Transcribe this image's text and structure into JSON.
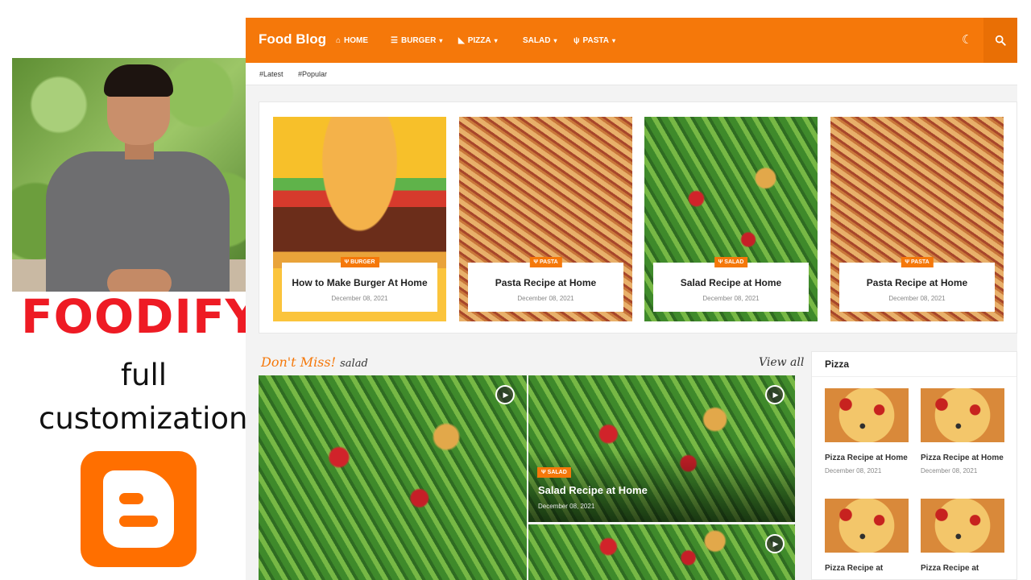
{
  "promo": {
    "title": "FOODIFY",
    "subtitle_line1": "full",
    "subtitle_line2": "customization"
  },
  "blog": {
    "brand": "Food Blog",
    "nav": [
      {
        "label": "HOME",
        "icon": "home-icon",
        "has_dropdown": false
      },
      {
        "label": "BURGER",
        "icon": "burger-icon",
        "has_dropdown": true
      },
      {
        "label": "PIZZA",
        "icon": "pizza-icon",
        "has_dropdown": true
      },
      {
        "label": "SALAD",
        "icon": "",
        "has_dropdown": true
      },
      {
        "label": "PASTA",
        "icon": "fork-knife-icon",
        "has_dropdown": true
      }
    ],
    "tags": [
      "#Latest",
      "#Popular"
    ],
    "featured": [
      {
        "category": "BURGER",
        "title": "How to Make Burger At Home",
        "date": "December 08, 2021",
        "image": "burger"
      },
      {
        "category": "PASTA",
        "title": "Pasta Recipe at Home",
        "date": "December 08, 2021",
        "image": "pasta"
      },
      {
        "category": "SALAD",
        "title": "Salad Recipe at Home",
        "date": "December 08, 2021",
        "image": "salad"
      },
      {
        "category": "PASTA",
        "title": "Pasta Recipe at Home",
        "date": "December 08, 2021",
        "image": "pasta"
      }
    ],
    "dont_miss": {
      "heading": "Don't Miss!",
      "category": "salad",
      "view_all": "View all",
      "post": {
        "category": "SALAD",
        "title": "Salad Recipe at Home",
        "date": "December 08, 2021"
      }
    },
    "widget": {
      "title": "Pizza",
      "items": [
        {
          "title": "Pizza Recipe at Home",
          "date": "December 08, 2021"
        },
        {
          "title": "Pizza Recipe at Home",
          "date": "December 08, 2021"
        },
        {
          "title": "Pizza Recipe at",
          "date": ""
        },
        {
          "title": "Pizza Recipe at",
          "date": ""
        }
      ]
    }
  },
  "colors": {
    "accent": "#f5780a",
    "promo_title": "#ee1b24",
    "blogger": "#ff6f00"
  }
}
